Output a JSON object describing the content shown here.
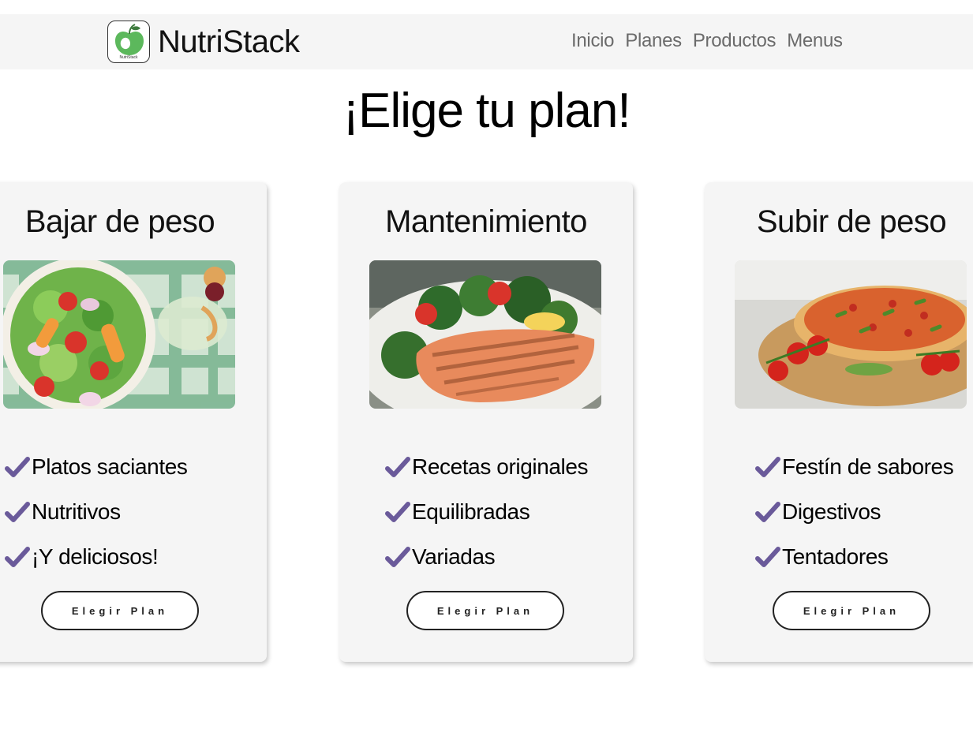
{
  "brand": {
    "name": "NutriStack",
    "logo_caption": "NutriStack",
    "logo_icon": "apple-icon"
  },
  "nav": {
    "links": [
      "Inicio",
      "Planes",
      "Productos",
      "Menus"
    ]
  },
  "page": {
    "title": "¡Elige tu plan!"
  },
  "colors": {
    "check": "#6a5a9a",
    "navbar_bg": "#f5f5f5",
    "card_bg": "#f5f5f5"
  },
  "plans": [
    {
      "title": "Bajar de peso",
      "image": "salad-image",
      "features": [
        "Platos saciantes",
        "Nutritivos",
        "¡Y deliciosos!"
      ],
      "button": "Elegir Plan"
    },
    {
      "title": "Mantenimiento",
      "image": "salmon-image",
      "features": [
        "Recetas originales",
        "Equilibradas",
        "Variadas"
      ],
      "button": "Elegir Plan"
    },
    {
      "title": "Subir de peso",
      "image": "pizza-image",
      "features": [
        "Festín de sabores",
        "Digestivos",
        "Tentadores"
      ],
      "button": "Elegir Plan"
    }
  ]
}
